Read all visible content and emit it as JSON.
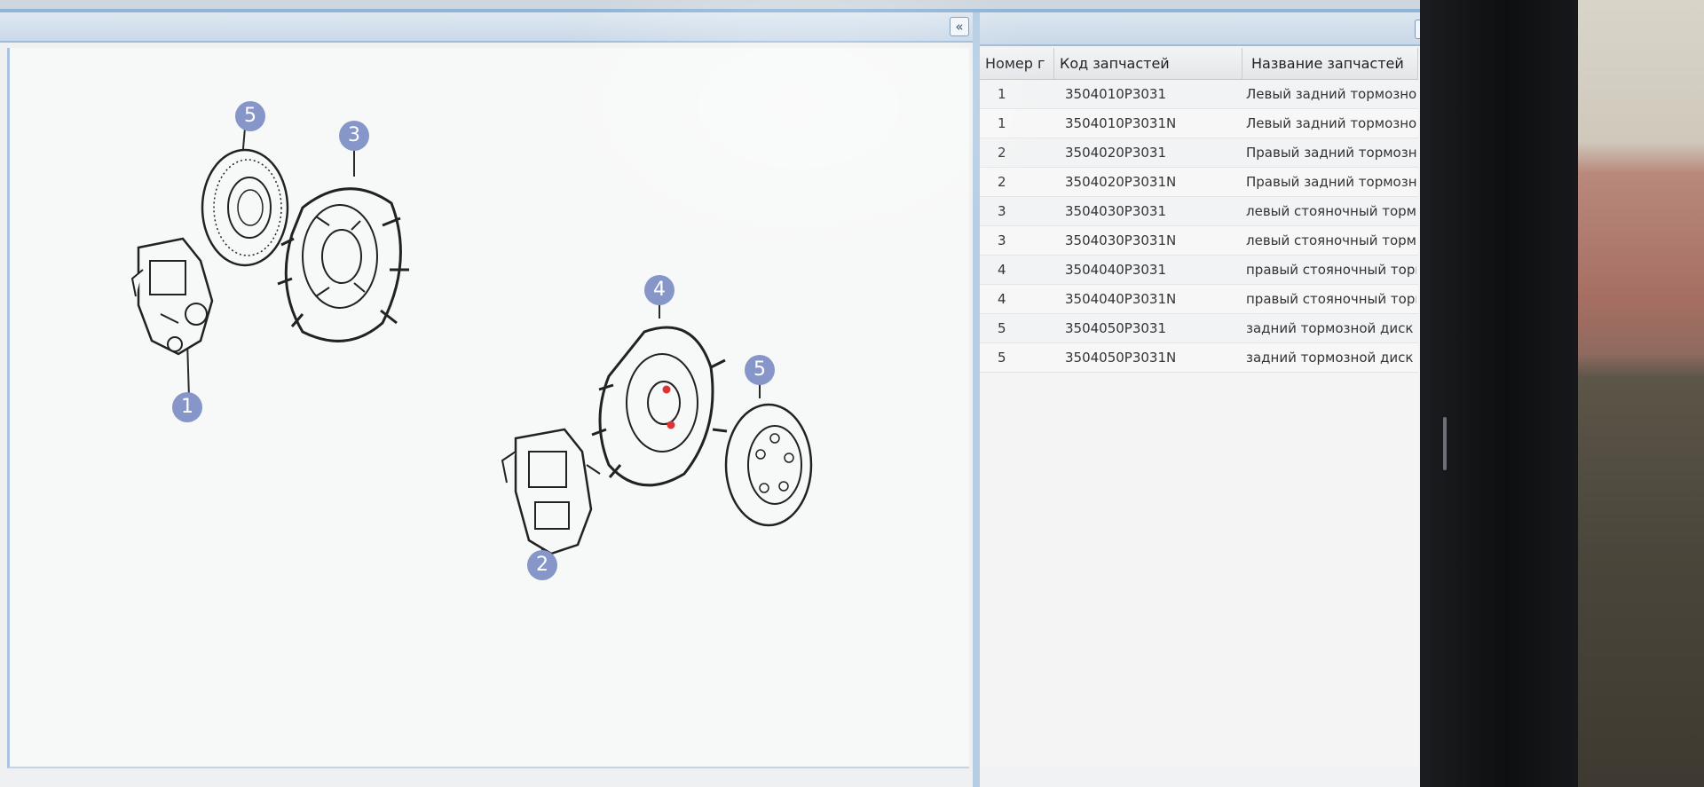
{
  "panels": {
    "collapse_glyph": "«"
  },
  "diagram": {
    "callouts": [
      {
        "label": "5"
      },
      {
        "label": "3"
      },
      {
        "label": "1"
      },
      {
        "label": "4"
      },
      {
        "label": "5"
      },
      {
        "label": "2"
      }
    ]
  },
  "table": {
    "headers": [
      "Номер г",
      "Код запчастей",
      "Название запчастей"
    ],
    "rows": [
      {
        "num": "1",
        "code": "3504010P3031",
        "name": "Левый задний тормозной су"
      },
      {
        "num": "1",
        "code": "3504010P3031N",
        "name": "Левый задний тормозной су"
      },
      {
        "num": "2",
        "code": "3504020P3031",
        "name": "Правый задний тормозной с"
      },
      {
        "num": "2",
        "code": "3504020P3031N",
        "name": "Правый задний тормозной с"
      },
      {
        "num": "3",
        "code": "3504030P3031",
        "name": "левый стояночный тормоз в"
      },
      {
        "num": "3",
        "code": "3504030P3031N",
        "name": "левый стояночный тормоз в"
      },
      {
        "num": "4",
        "code": "3504040P3031",
        "name": "правый стояночный тормоз"
      },
      {
        "num": "4",
        "code": "3504040P3031N",
        "name": "правый стояночный тормоз"
      },
      {
        "num": "5",
        "code": "3504050P3031",
        "name": "задний тормозной диск"
      },
      {
        "num": "5",
        "code": "3504050P3031N",
        "name": "задний тормозной диск"
      }
    ],
    "scroll_left": "◂",
    "scroll_right": "▸"
  },
  "colors": {
    "callout": "#8796c8",
    "header_blue": "#c9d8e8",
    "accent_border": "#9dbcd9"
  }
}
